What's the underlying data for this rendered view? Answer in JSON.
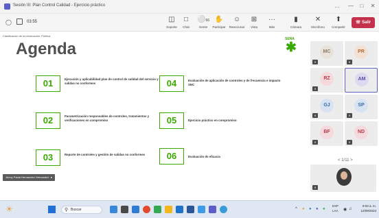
{
  "window": {
    "title": "Sesión III: Plan Control Calidad - Ejercicio práctico",
    "controls": [
      "…",
      "—",
      "□",
      "✕"
    ]
  },
  "toolbar": {
    "timer": "03:55",
    "buttons": [
      {
        "label": "Soporte",
        "icon": "share-tray-icon"
      },
      {
        "label": "Chat",
        "icon": "chat-icon"
      },
      {
        "label": "Gente",
        "icon": "people-icon",
        "badge": "66"
      },
      {
        "label": "Participar",
        "icon": "raise-hand-icon"
      },
      {
        "label": "Reaccionar",
        "icon": "smile-icon"
      },
      {
        "label": "Vista",
        "icon": "view-icon"
      },
      {
        "label": "Más",
        "icon": "more-icon"
      },
      {
        "label": "Cámara",
        "icon": "camera-off-icon"
      },
      {
        "label": "Micrófono",
        "icon": "mic-off-icon"
      },
      {
        "label": "Compartir",
        "icon": "share-icon"
      }
    ],
    "leave_label": "Salir",
    "accent": "#c4314b"
  },
  "slide": {
    "classification": "Clasificación de la información: Pública",
    "title": "Agenda",
    "logo_text": "SENA",
    "accent": "#39a900",
    "items": [
      {
        "number": "01",
        "text": "Ejecución y aplicabilidad plan de control de calidad del servicio y salidas no conformes"
      },
      {
        "number": "02",
        "text": "Parametrización responsables de controles, tratamientos y verificaciones en compromiso"
      },
      {
        "number": "03",
        "text": "Reporte de controles y gestión de salidas no conformes"
      },
      {
        "number": "04",
        "text": "Evaluación de aplicación de controles y de frecuencia e impacto SNC"
      },
      {
        "number": "05",
        "text": "Ejercicio práctico en compromiso"
      },
      {
        "number": "06",
        "text": "Evaluación de eficacia"
      }
    ],
    "speaker": "Jenny Paola Hernandez Hernandez"
  },
  "gallery": {
    "participants": [
      {
        "initials": "MC",
        "bg": "#e8e2da",
        "fg": "#8a7a62"
      },
      {
        "initials": "PR",
        "bg": "#f3e1d4",
        "fg": "#b2693b"
      },
      {
        "initials": "RZ",
        "bg": "#f6d9dc",
        "fg": "#b23a48"
      },
      {
        "initials": "AM",
        "bg": "#ded8f0",
        "fg": "#5b4ba5"
      },
      {
        "initials": "GJ",
        "bg": "#d7e3f2",
        "fg": "#3a6aa8"
      },
      {
        "initials": "SP",
        "bg": "#d7e3f2",
        "fg": "#3a6aa8"
      },
      {
        "initials": "BF",
        "bg": "#f6d9dc",
        "fg": "#b23a48"
      },
      {
        "initials": "ND",
        "bg": "#f6d9dc",
        "fg": "#b23a48"
      }
    ],
    "pager": "1/11"
  },
  "taskbar": {
    "search_label": "Buscar",
    "tray_lang": "ESP",
    "tray_sub": "LAA",
    "time": "9:03 a. m.",
    "date": "12/09/2023"
  }
}
